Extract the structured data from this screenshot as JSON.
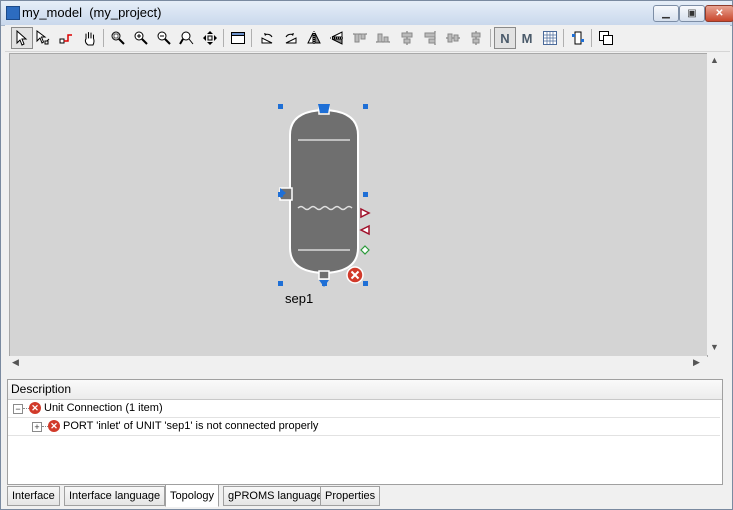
{
  "window": {
    "title": "my_model  (my_project)",
    "minimize_glyph": "▁",
    "maximize_glyph": "▣",
    "close_glyph": "✕"
  },
  "toolbar": {
    "tools": [
      {
        "name": "select-pointer-tool",
        "icon": "arrow-pointer-icon"
      },
      {
        "name": "select-connection-tool",
        "icon": "arrow-link-icon"
      },
      {
        "name": "connect-tool",
        "icon": "connector-icon"
      },
      {
        "name": "pan-tool",
        "icon": "hand-icon"
      },
      {
        "name": "zoom-area-tool",
        "icon": "zoom-area-icon"
      },
      {
        "name": "zoom-in-tool",
        "icon": "zoom-in-icon"
      },
      {
        "name": "zoom-out-tool",
        "icon": "zoom-out-icon"
      },
      {
        "name": "zoom-select-tool",
        "icon": "zoom-select-icon"
      },
      {
        "name": "fit-to-window-tool",
        "icon": "fit-arrows-icon"
      },
      {
        "name": "properties-tool",
        "icon": "window-icon"
      },
      {
        "name": "rotate-left-tool",
        "icon": "rotate-left-icon"
      },
      {
        "name": "rotate-right-tool",
        "icon": "rotate-right-icon"
      },
      {
        "name": "flip-horizontal-tool",
        "icon": "flip-horizontal-icon"
      },
      {
        "name": "flip-vertical-tool",
        "icon": "flip-vertical-icon"
      },
      {
        "name": "align-top-tool",
        "icon": "align-top-icon"
      },
      {
        "name": "align-bottom-tool",
        "icon": "align-bottom-icon"
      },
      {
        "name": "align-left-tool",
        "icon": "align-left-icon"
      },
      {
        "name": "align-right-tool",
        "icon": "align-right-icon"
      },
      {
        "name": "align-center-tool",
        "icon": "align-center-icon"
      },
      {
        "name": "align-middle-tool",
        "icon": "align-middle-icon"
      },
      {
        "name": "show-names-tool",
        "icon": "letter-n-icon",
        "label": "N",
        "pressed": true
      },
      {
        "name": "show-model-tool",
        "icon": "letter-m-icon",
        "label": "M"
      },
      {
        "name": "grid-tool",
        "icon": "grid-icon"
      },
      {
        "name": "ports-tool",
        "icon": "ports-icon"
      },
      {
        "name": "layers-tool",
        "icon": "layers-icon"
      }
    ]
  },
  "canvas": {
    "unit_label": "sep1",
    "colors": {
      "background": "#d4d4d4",
      "vessel": "#6f6f6f",
      "handle": "#1e6fd6",
      "error": "#d13a2a"
    }
  },
  "description": {
    "header": "Description",
    "group_label": "Unit Connection (1 item)",
    "item_label": "PORT 'inlet' of UNIT 'sep1' is not connected properly"
  },
  "tabs": [
    {
      "label": "Interface",
      "active": false
    },
    {
      "label": "Interface language",
      "active": false
    },
    {
      "label": "Topology",
      "active": true
    },
    {
      "label": "gPROMS language",
      "active": false
    },
    {
      "label": "Properties",
      "active": false
    }
  ]
}
